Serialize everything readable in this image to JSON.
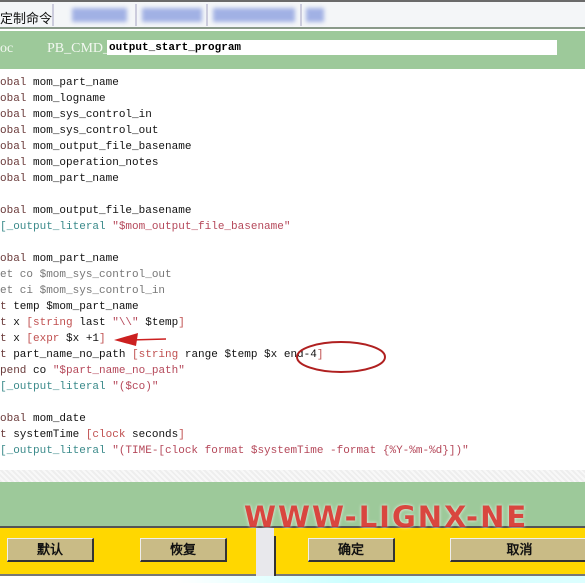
{
  "tabs": {
    "active": "定制命令"
  },
  "header": {
    "left_label": "oc",
    "field_label": "PB_CMD_",
    "field_value": "output_start_program"
  },
  "code_lines": [
    [
      [
        "obal ",
        "k"
      ],
      [
        "mom_part_name",
        "b"
      ]
    ],
    [
      [
        "obal ",
        "k"
      ],
      [
        "mom_logname",
        "b"
      ]
    ],
    [
      [
        "obal ",
        "k"
      ],
      [
        "mom_sys_control_in",
        "b"
      ]
    ],
    [
      [
        "obal ",
        "k"
      ],
      [
        "mom_sys_control_out",
        "b"
      ]
    ],
    [
      [
        "obal ",
        "k"
      ],
      [
        "mom_output_file_basename",
        "b"
      ]
    ],
    [
      [
        "obal ",
        "k"
      ],
      [
        "mom_operation_notes",
        "b"
      ]
    ],
    [
      [
        "obal ",
        "k"
      ],
      [
        "mom_part_name",
        "b"
      ]
    ],
    [],
    [
      [
        "obal ",
        "k"
      ],
      [
        "mom_output_file_basename",
        "b"
      ]
    ],
    [
      [
        "[_output_literal ",
        "t"
      ],
      [
        "\"$mom_output_file_basename\"",
        "s"
      ]
    ],
    [],
    [
      [
        "obal ",
        "k"
      ],
      [
        "mom_part_name",
        "b"
      ]
    ],
    [
      [
        "et co $mom_sys_control_out",
        "g"
      ]
    ],
    [
      [
        "et ci $mom_sys_control_in",
        "g"
      ]
    ],
    [
      [
        "t ",
        "k"
      ],
      [
        "temp $mom_part_name",
        "b"
      ]
    ],
    [
      [
        "t ",
        "k"
      ],
      [
        "x ",
        "b"
      ],
      [
        "[string ",
        "br"
      ],
      [
        "last ",
        "b"
      ],
      [
        "\"\\\\\" ",
        "s"
      ],
      [
        "$temp",
        "b"
      ],
      [
        "]",
        "br"
      ]
    ],
    [
      [
        "t ",
        "k"
      ],
      [
        "x ",
        "b"
      ],
      [
        "[expr ",
        "br"
      ],
      [
        "$x +1",
        "b"
      ],
      [
        "]",
        "br"
      ]
    ],
    [
      [
        "t ",
        "k"
      ],
      [
        "part_name_no_path ",
        "b"
      ],
      [
        "[string ",
        "br"
      ],
      [
        "range $temp $x end-4",
        "b"
      ],
      [
        "]",
        "br"
      ]
    ],
    [
      [
        "pend ",
        "k"
      ],
      [
        "co ",
        "b"
      ],
      [
        "\"$part_name_no_path\"",
        "s"
      ]
    ],
    [
      [
        "[_output_literal ",
        "t"
      ],
      [
        "\"($co)\"",
        "s"
      ]
    ],
    [],
    [
      [
        "obal ",
        "k"
      ],
      [
        "mom_date",
        "b"
      ]
    ],
    [
      [
        "t ",
        "k"
      ],
      [
        "systemTime ",
        "b"
      ],
      [
        "[clock ",
        "br"
      ],
      [
        "seconds",
        "b"
      ],
      [
        "]",
        "br"
      ]
    ],
    [
      [
        "[_output_literal ",
        "t"
      ],
      [
        "\"(TIME-[clock format $systemTime -format {%Y-%m-%d}])\"",
        "s"
      ]
    ]
  ],
  "buttons": {
    "default": "默认",
    "restore": "恢复",
    "ok": "确定",
    "cancel": "取消"
  },
  "watermark": "WWW-LIGNX-NE",
  "annotation_color": "#cc2020"
}
